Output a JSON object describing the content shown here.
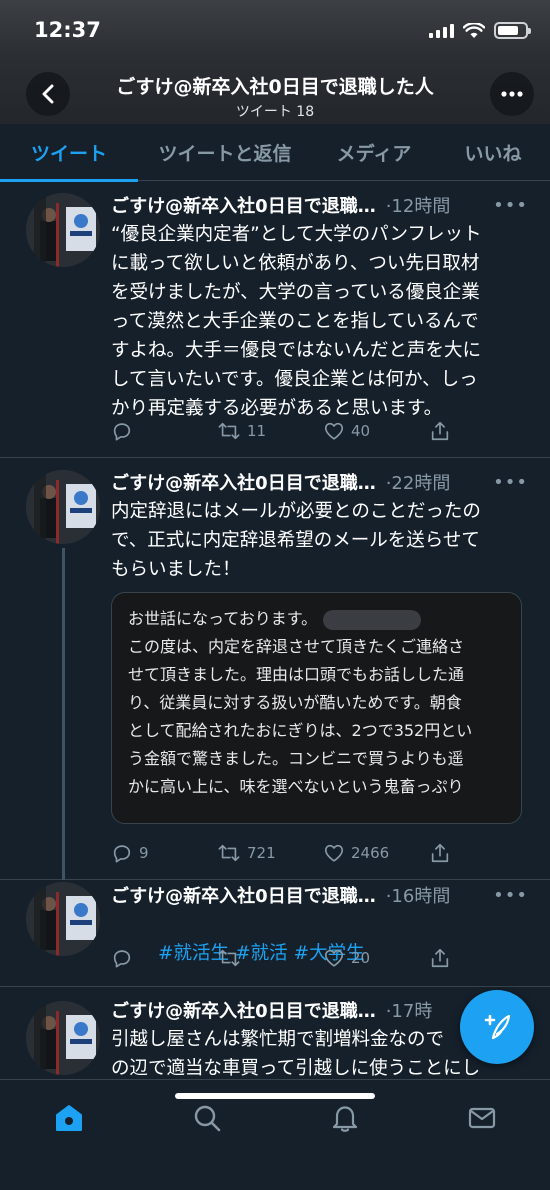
{
  "status": {
    "time": "12:37"
  },
  "header": {
    "title": "ごすけ@新卒入社0日目で退職した人",
    "subtitle": "ツイート 18"
  },
  "tabs": [
    {
      "label": "ツイート",
      "active": true
    },
    {
      "label": "ツイートと返信",
      "active": false
    },
    {
      "label": "メディア",
      "active": false
    },
    {
      "label": "いいね",
      "active": false
    }
  ],
  "tweets": [
    {
      "author": "ごすけ@新卒入社0日目で退職…",
      "time": "·12時間",
      "text": "“優良企業内定者”として大学のパンフレット\nに載って欲しいと依頼があり、つい先日取材\nを受けましたが、大学の言っている優良企業\nって漠然と大手企業のことを指しているんで\nすよね。大手＝優良ではないんだと声を大に\nして言いたいです。優良企業とは何か、しっ\nかり再定義する必要があると思います。",
      "replies": "",
      "retweets": "11",
      "likes": "40"
    },
    {
      "author": "ごすけ@新卒入社0日目で退職…",
      "time": "·22時間",
      "text": "内定辞退にはメールが必要とのことだったの\nで、正式に内定辞退希望のメールを送らせて\nもらいました！",
      "quote_line1": "お世話になっております。",
      "quote_rest": "\nこの度は、内定を辞退させて頂きたくご連絡さ\nせて頂きました。理由は口頭でもお話しした通\nり、従業員に対する扱いが酷いためです。朝食\nとして配給されたおにぎりは、2つで352円とい\nう金額で驚きました。コンビニで買うよりも遥\nかに高い上に、味を選べないという鬼畜っぷり",
      "replies": "9",
      "retweets": "721",
      "likes": "2466"
    },
    {
      "author": "ごすけ@新卒入社0日目で退職…",
      "time": "·16時間",
      "hashtags": [
        "#就活生",
        "#就活",
        "#大学生"
      ],
      "replies": "",
      "retweets": "",
      "likes": "20"
    },
    {
      "author": "ごすけ@新卒入社0日目で退職…",
      "time": "·17時",
      "text": "引越し屋さんは繁忙期で割増料金なので\nの辺で適当な車買って引越しに使うことにし"
    }
  ],
  "colors": {
    "accent": "#1da1f2",
    "background": "#15202b",
    "muted": "#8899a6",
    "border": "#38444d"
  },
  "icons": {
    "back": "chevron-left-icon",
    "more": "more-horizontal-icon",
    "reply": "reply-icon",
    "retweet": "retweet-icon",
    "like": "heart-icon",
    "share": "share-icon",
    "compose": "compose-tweet-icon",
    "home": "home-icon",
    "search": "search-icon",
    "notifications": "bell-icon",
    "messages": "mail-icon"
  }
}
